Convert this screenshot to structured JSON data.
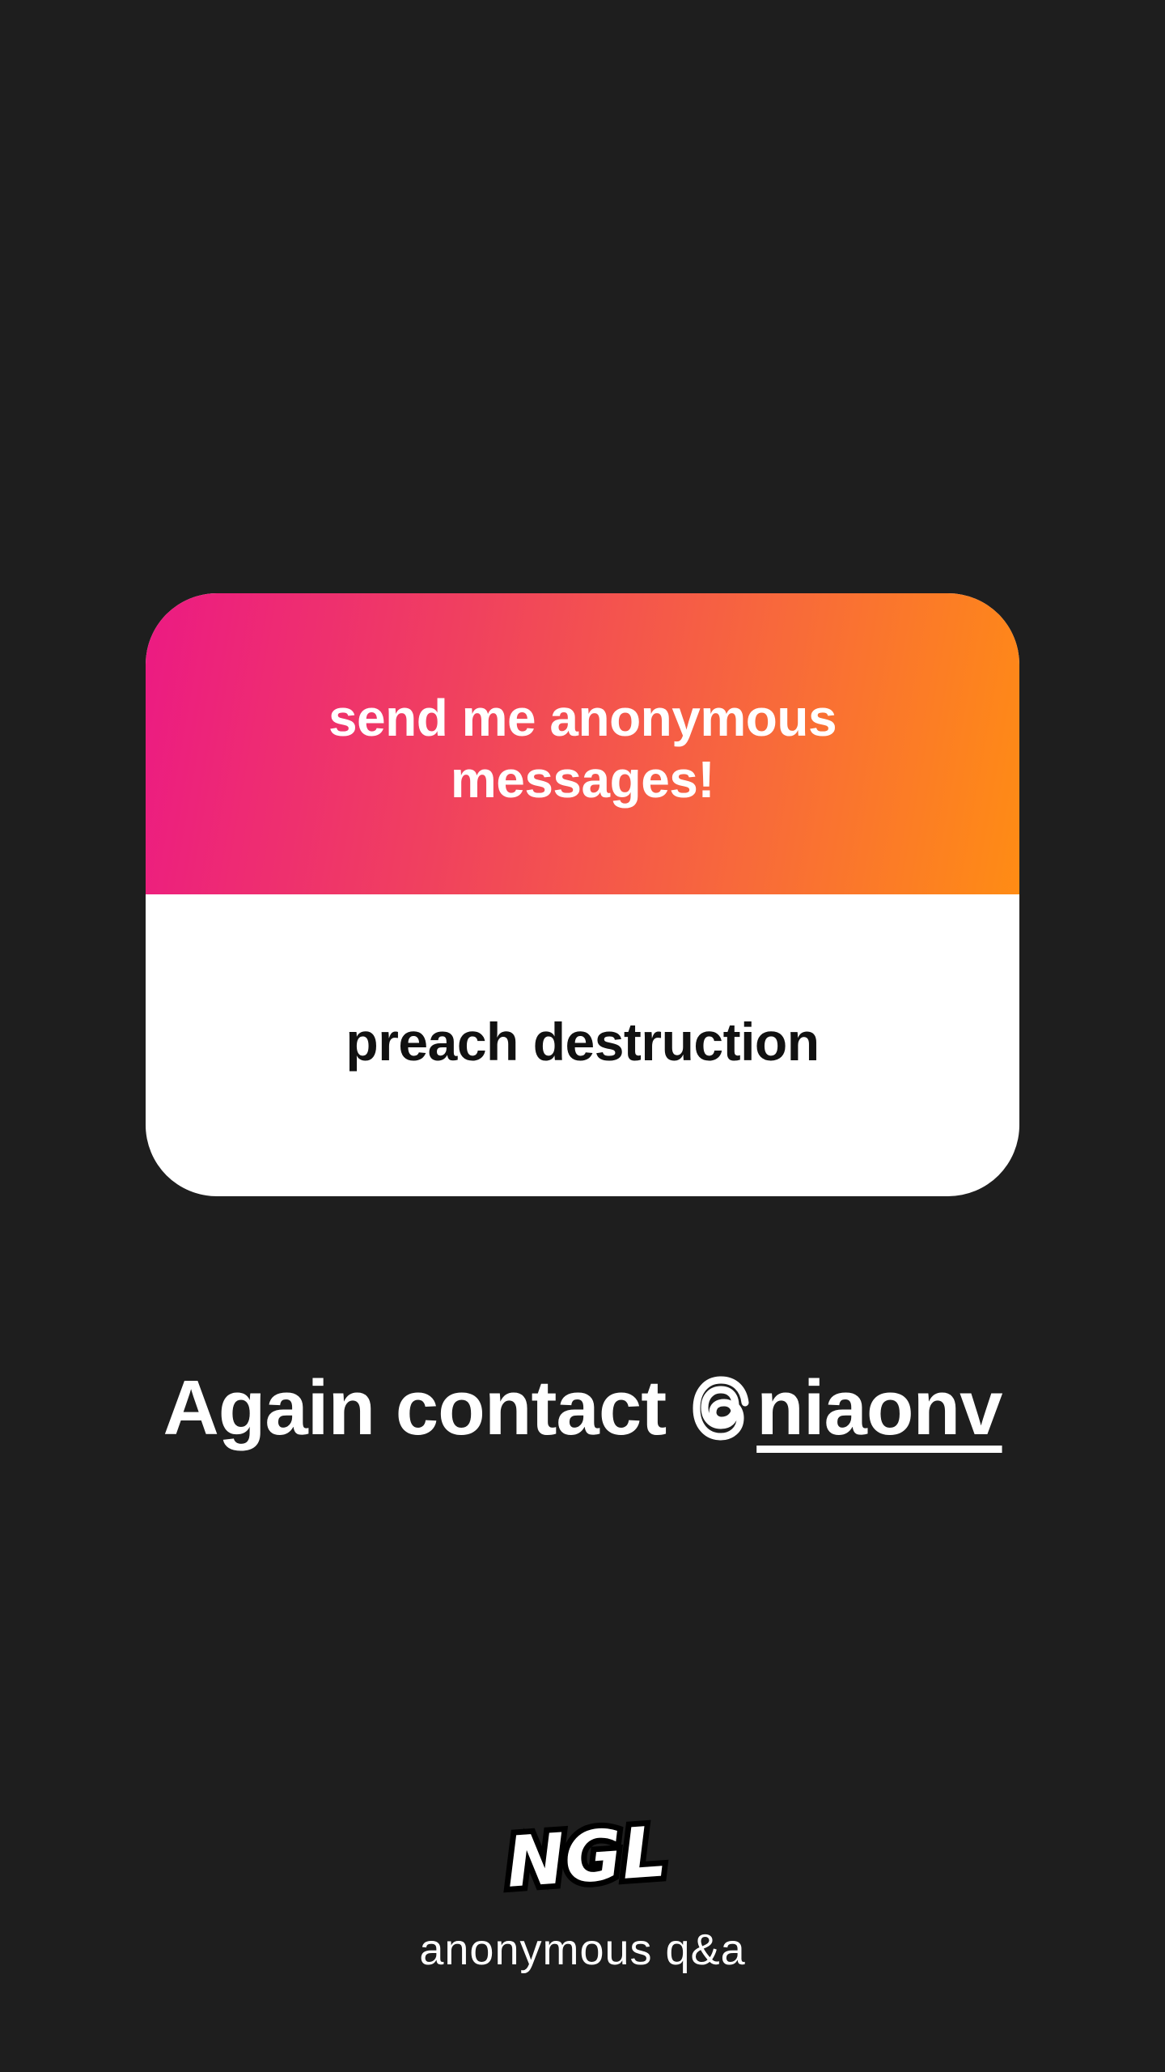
{
  "card": {
    "prompt": "send me anonymous messages!",
    "answer": "preach destruction",
    "gradient_start": "#ec1a83",
    "gradient_end": "#ff8c14"
  },
  "contact": {
    "prefix": "Again contact",
    "icon": "threads-icon",
    "handle": "niaonv"
  },
  "branding": {
    "logo_text": "NGL",
    "tagline": "anonymous q&a"
  },
  "colors": {
    "background": "#1e1e1e",
    "card_body": "#ffffff"
  }
}
